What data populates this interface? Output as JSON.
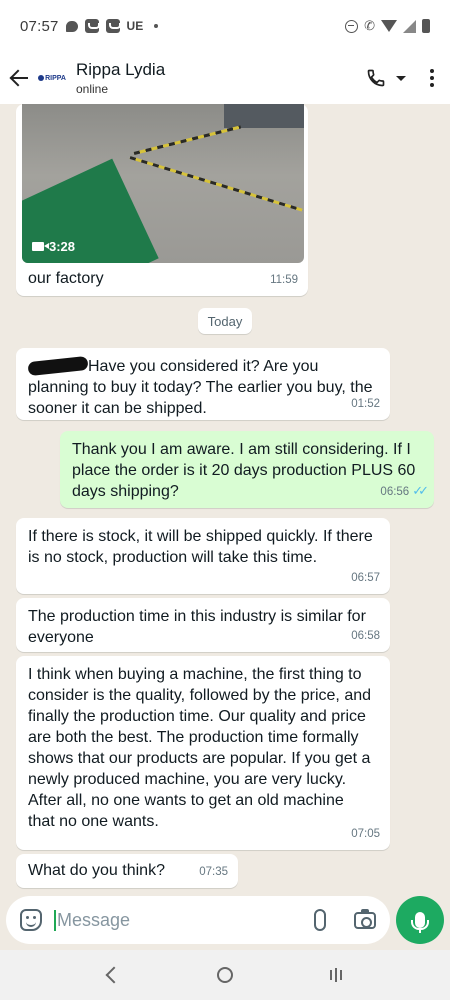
{
  "status_bar": {
    "time": "07:57",
    "carrier": "UE"
  },
  "header": {
    "contact_name": "Rippa Lydia",
    "contact_status": "online",
    "avatar_logo_text": "RIPPA"
  },
  "messages": {
    "video": {
      "duration": "3:28",
      "caption": "our factory",
      "time": "11:59"
    },
    "date_chip": "Today",
    "m1": {
      "text": "Have you considered it? Are you planning to buy it today? The earlier you buy, the sooner it can be shipped.",
      "time": "01:52"
    },
    "m2": {
      "text": "Thank you I am aware. I am still considering. If I place the order is it 20 days production PLUS 60 days shipping?",
      "time": "06:56",
      "ticks": "✓✓"
    },
    "m3": {
      "text": "If there is stock, it will be shipped quickly. If there is no stock, production will take this time.",
      "time": "06:57"
    },
    "m4": {
      "text": "The production time in this industry is similar for everyone",
      "time": "06:58"
    },
    "m5": {
      "text": "I think when buying a machine, the first thing to consider is the quality, followed by the price, and finally the production time. Our quality and price are both the best. The production time formally shows that our products are popular. If you get a newly produced machine, you are very lucky. After all, no one wants to get an old machine that no one wants.",
      "time": "07:05"
    },
    "m6": {
      "text": "What do you think?",
      "time": "07:35"
    }
  },
  "input": {
    "placeholder": "Message",
    "value": ""
  },
  "colors": {
    "chat_bg": "#efeae2",
    "incoming": "#ffffff",
    "outgoing": "#d9fdd3",
    "accent": "#1daa61",
    "read_ticks": "#53bdeb"
  }
}
